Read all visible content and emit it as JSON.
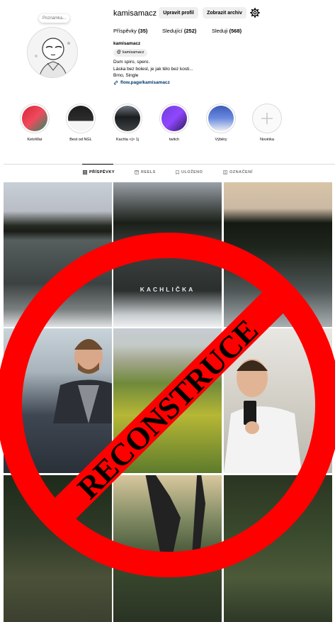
{
  "profile": {
    "username": "kamisamacz",
    "note_text": "Poznámka...",
    "edit_profile_label": "Upravit profil",
    "view_archive_label": "Zobrazit archiv",
    "stats": {
      "posts_label": "Příspěvky",
      "posts_count": "(35)",
      "followers_label": "Sledující",
      "followers_count": "(252)",
      "following_label": "Sleduji",
      "following_count": "(568)"
    },
    "bio": {
      "name": "kamisamacz",
      "threads_handle": "kamisamacz",
      "lines": [
        "Dum spiro, spero.",
        "Láska bez bolest, je jak tělo bez kosti...",
        "Brno, Single"
      ],
      "link": "flow.page/kamisamacz"
    }
  },
  "highlights": [
    {
      "label": "KetoWar",
      "icon": "ketowar-thumb"
    },
    {
      "label": "Best od NGL",
      "icon": "ngl-thumb"
    },
    {
      "label": "Kachla <|> 1j",
      "icon": "kachla-thumb"
    },
    {
      "label": "twitch",
      "icon": "twitch-thumb"
    },
    {
      "label": "Výběry",
      "icon": "vybery-thumb"
    },
    {
      "label": "Novinka",
      "icon": "plus-icon"
    }
  ],
  "tabs": [
    {
      "label": "PŘÍSPĚVKY",
      "icon": "grid-icon",
      "active": true
    },
    {
      "label": "REELS",
      "icon": "reels-icon",
      "active": false
    },
    {
      "label": "ULOŽENO",
      "icon": "bookmark-icon",
      "active": false
    },
    {
      "label": "OZNAČENÍ",
      "icon": "tagged-icon",
      "active": false
    }
  ],
  "grid": {
    "post_caption_text": "KACHLIČKA",
    "overlay_text": "RECONSTRUCE"
  },
  "colors": {
    "link": "#00376b",
    "button_bg": "#efefef",
    "overlay_red": "#ff0000"
  }
}
